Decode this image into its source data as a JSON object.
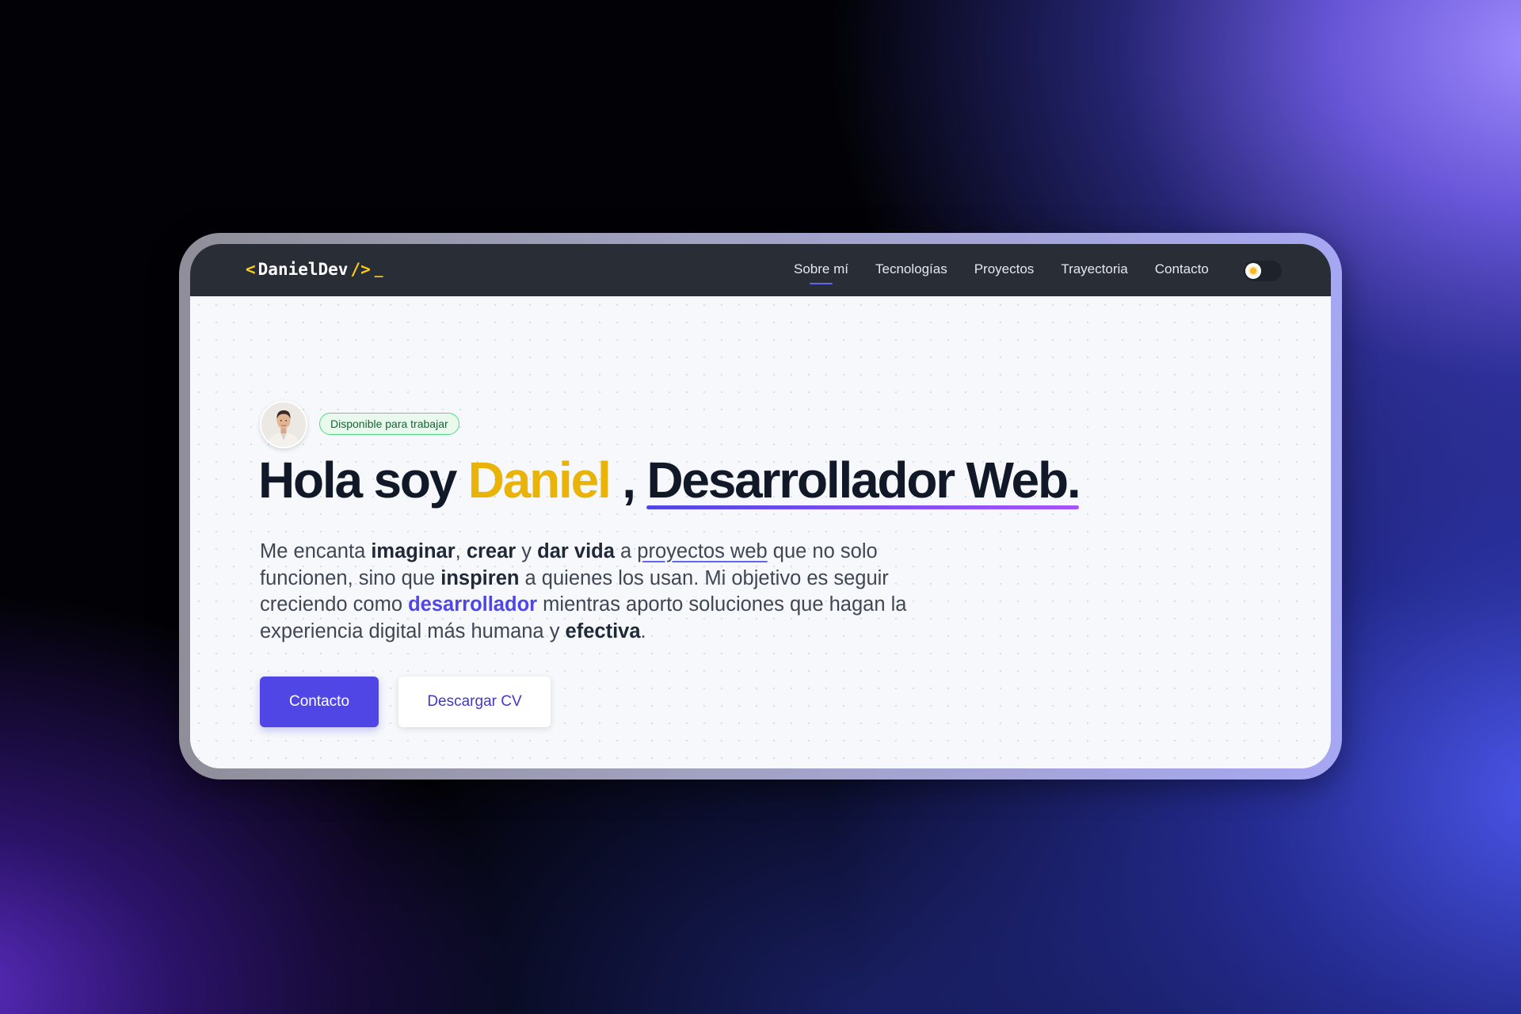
{
  "brand": {
    "open": "<",
    "name": "DanielDev",
    "close": "/>",
    "cursor": "_"
  },
  "nav": {
    "items": [
      "Sobre mí",
      "Tecnologías",
      "Proyectos",
      "Trayectoria",
      "Contacto"
    ],
    "active": "Sobre mí"
  },
  "theme_toggle": {
    "icon": "sun-icon",
    "state": "light"
  },
  "hero": {
    "avatar": "person-avatar",
    "badge": "Disponible para trabajar",
    "headline": {
      "greeting": "Hola soy ",
      "name": "Daniel",
      "separator": " , ",
      "role": "Desarrollador Web."
    },
    "bio": {
      "p1": "Me encanta ",
      "b1": "imaginar",
      "p2": ", ",
      "b2": "crear",
      "p3": " y ",
      "b3": "dar vida",
      "p4": " a ",
      "link": "proyectos web",
      "p5": " que no solo funcionen, sino que ",
      "b4": "inspiren",
      "p6": " a quienes los usan. Mi objetivo es seguir creciendo como ",
      "accent": "desarrollador",
      "p7": " mientras aporto soluciones que hagan la experiencia digital más humana y ",
      "b5": "efectiva",
      "p8": "."
    },
    "buttons": {
      "primary": "Contacto",
      "secondary": "Descargar CV"
    }
  },
  "colors": {
    "accent": "#4f46e5",
    "name_highlight": "#eab308",
    "navbar_bg": "#282d36",
    "badge_border": "#4ade80"
  }
}
